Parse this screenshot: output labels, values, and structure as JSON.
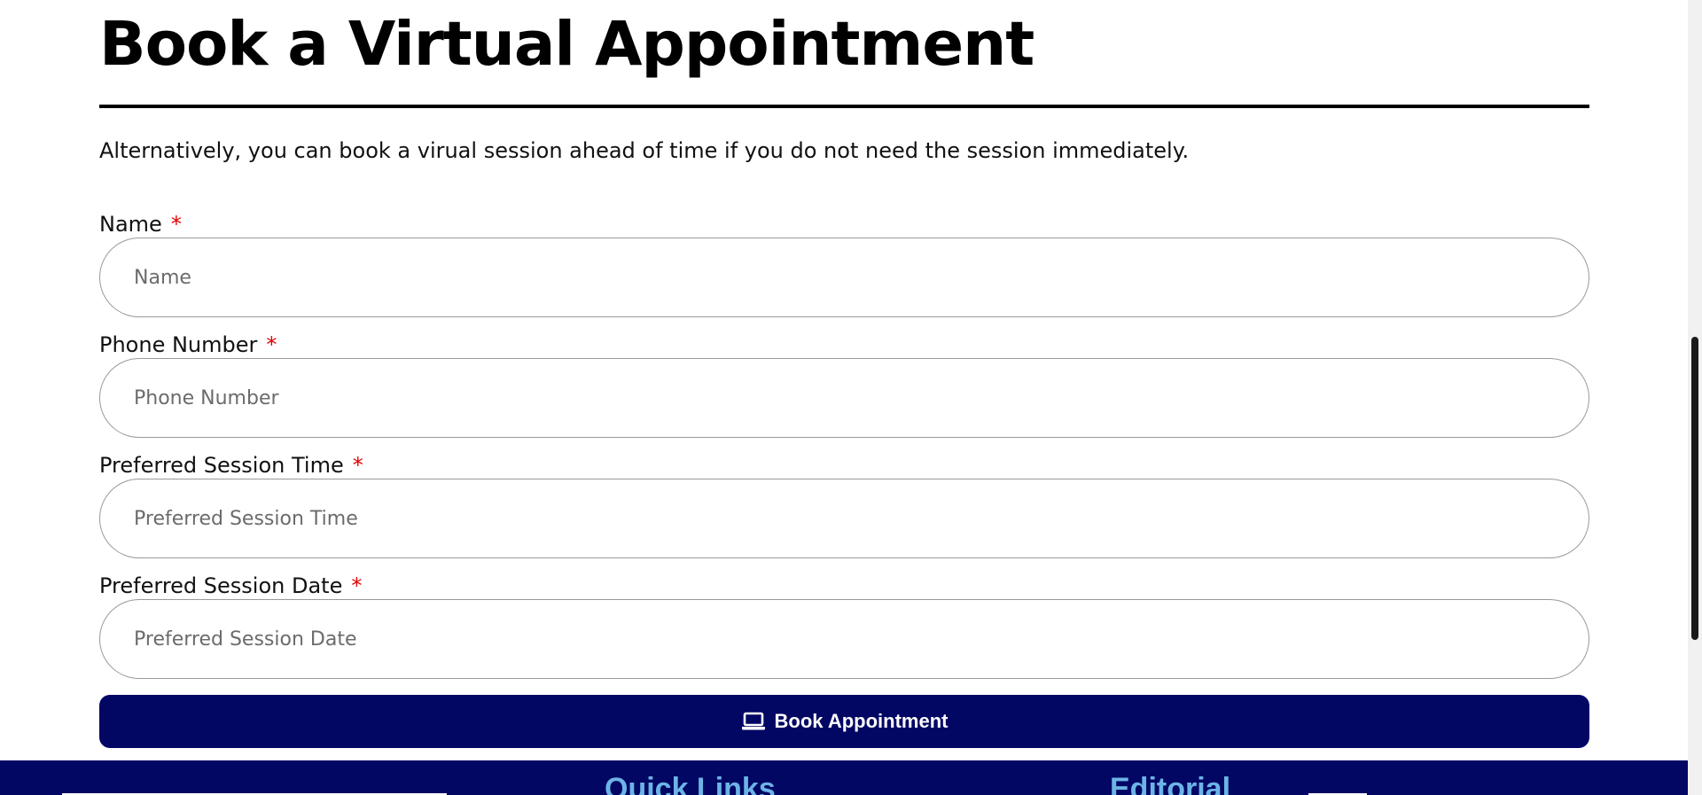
{
  "page": {
    "title": "Book a Virtual Appointment",
    "intro": "Alternatively, you can book a virual session ahead of time if you do not need the session immediately."
  },
  "form": {
    "required_marker": "*",
    "fields": [
      {
        "label": "Name",
        "placeholder": "Name",
        "value": ""
      },
      {
        "label": "Phone Number",
        "placeholder": "Phone Number",
        "value": ""
      },
      {
        "label": "Preferred Session Time",
        "placeholder": "Preferred Session Time",
        "value": ""
      },
      {
        "label": "Preferred Session Date",
        "placeholder": "Preferred Session Date",
        "value": ""
      }
    ],
    "submit": {
      "label": "Book Appointment",
      "icon": "laptop-icon"
    }
  },
  "footer": {
    "headings": [
      "Quick Links",
      "Editorial"
    ]
  },
  "colors": {
    "accent": "#020764",
    "required": "#e00000",
    "footer_heading": "#6db4e6"
  }
}
